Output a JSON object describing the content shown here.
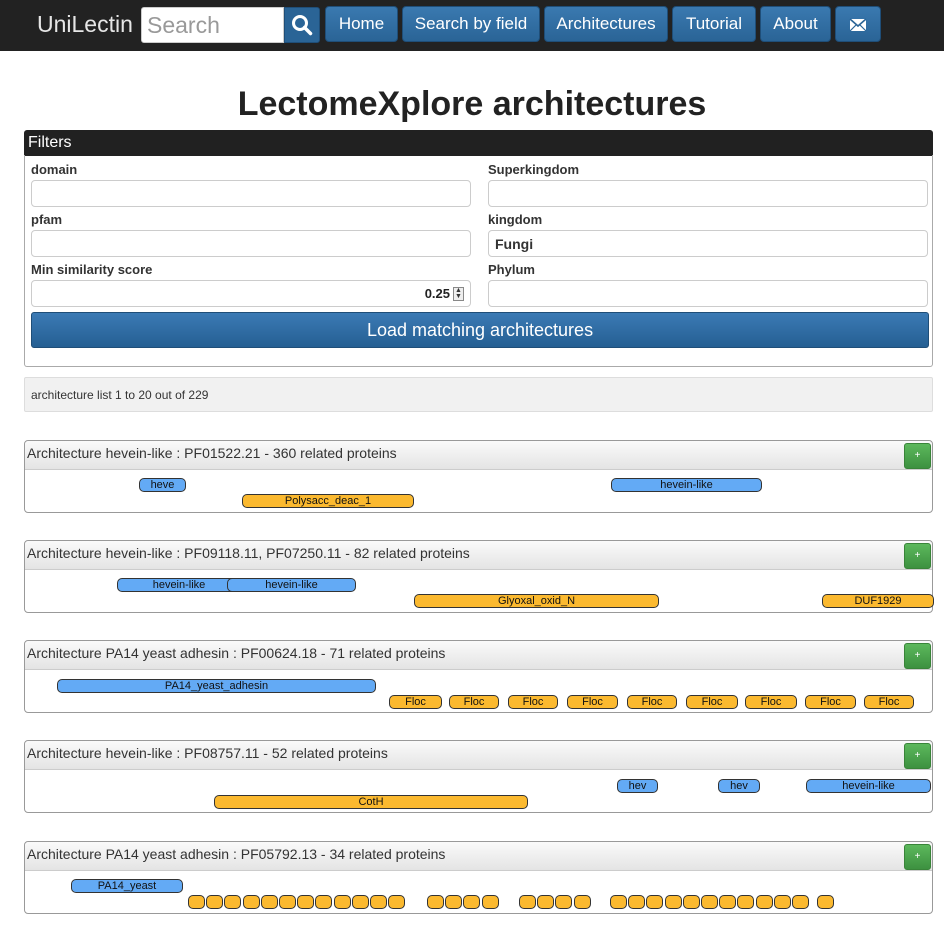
{
  "navbar": {
    "brand": "UniLectin",
    "search_placeholder": "Search",
    "items": [
      "Home",
      "Search by field",
      "Architectures",
      "Tutorial",
      "About"
    ],
    "icons": {
      "search": "search-icon",
      "mail": "envelope-icon"
    }
  },
  "page_title": "LectomeXplore architectures",
  "filters": {
    "header": "Filters",
    "domain_label": "domain",
    "domain_value": "",
    "superkingdom_label": "Superkingdom",
    "superkingdom_value": "",
    "pfam_label": "pfam",
    "pfam_value": "",
    "kingdom_label": "kingdom",
    "kingdom_value": "Fungi",
    "min_score_label": "Min similarity score",
    "min_score_value": "0.25",
    "phylum_label": "Phylum",
    "phylum_value": "",
    "load_button": "Load matching architectures"
  },
  "list_info": "architecture list 1 to 20 out of 229",
  "colors": {
    "blue_domain": "#63aaf5",
    "orange_domain": "#fbb92f",
    "nav_button": "#2a6496",
    "plus_button": "#5cb85c"
  },
  "architectures": [
    {
      "title": "Architecture hevein-like : PF01522.21 - 360 related proteins",
      "plus": "+",
      "domains": [
        {
          "label": "heve",
          "color": "blue"
        },
        {
          "label": "Polysacc_deac_1",
          "color": "orange"
        },
        {
          "label": "hevein-like",
          "color": "blue"
        }
      ]
    },
    {
      "title": "Architecture hevein-like : PF09118.11, PF07250.11 - 82 related proteins",
      "plus": "+",
      "domains": [
        {
          "label": "hevein-like",
          "color": "blue"
        },
        {
          "label": "hevein-like",
          "color": "blue"
        },
        {
          "label": "Glyoxal_oxid_N",
          "color": "orange"
        },
        {
          "label": "DUF1929",
          "color": "orange"
        }
      ]
    },
    {
      "title": "Architecture PA14 yeast adhesin : PF00624.18 - 71 related proteins",
      "plus": "+",
      "domains": [
        {
          "label": "PA14_yeast_adhesin",
          "color": "blue"
        },
        {
          "label": "Floc",
          "color": "orange"
        },
        {
          "label": "Floc",
          "color": "orange"
        },
        {
          "label": "Floc",
          "color": "orange"
        },
        {
          "label": "Floc",
          "color": "orange"
        },
        {
          "label": "Floc",
          "color": "orange"
        },
        {
          "label": "Floc",
          "color": "orange"
        },
        {
          "label": "Floc",
          "color": "orange"
        },
        {
          "label": "Floc",
          "color": "orange"
        },
        {
          "label": "Floc",
          "color": "orange"
        }
      ]
    },
    {
      "title": "Architecture hevein-like : PF08757.11 - 52 related proteins",
      "plus": "+",
      "domains": [
        {
          "label": "hev",
          "color": "blue"
        },
        {
          "label": "hev",
          "color": "blue"
        },
        {
          "label": "hevein-like",
          "color": "blue"
        },
        {
          "label": "CotH",
          "color": "orange"
        }
      ]
    },
    {
      "title": "Architecture PA14 yeast adhesin : PF05792.13 - 34 related proteins",
      "plus": "+",
      "domains": [
        {
          "label": "PA14_yeast",
          "color": "blue"
        }
      ]
    }
  ]
}
